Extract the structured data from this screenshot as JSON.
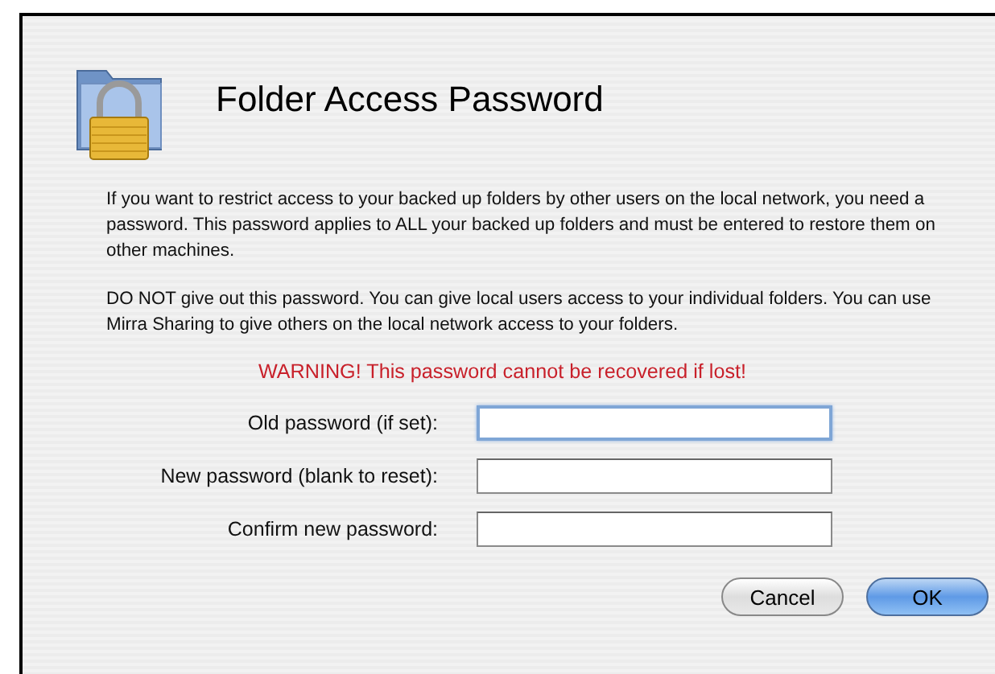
{
  "dialog": {
    "title": "Folder Access Password",
    "paragraphs": [
      "If you want to restrict access to your backed up folders by other users on the local network, you need a password. This password  applies to ALL your backed up folders and must be entered to restore them on other machines.",
      "DO NOT give out this password. You can give local users access to your individual folders. You can use Mirra Sharing to give others on the local network access to your folders."
    ],
    "warning": "WARNING! This password cannot be recovered if lost!",
    "fields": [
      {
        "label": "Old password (if set):",
        "focused": true
      },
      {
        "label": "New password (blank to reset):",
        "focused": false
      },
      {
        "label": "Confirm new password:",
        "focused": false
      }
    ],
    "buttons": [
      {
        "label": "Cancel",
        "default": false
      },
      {
        "label": "OK",
        "default": true
      }
    ]
  }
}
